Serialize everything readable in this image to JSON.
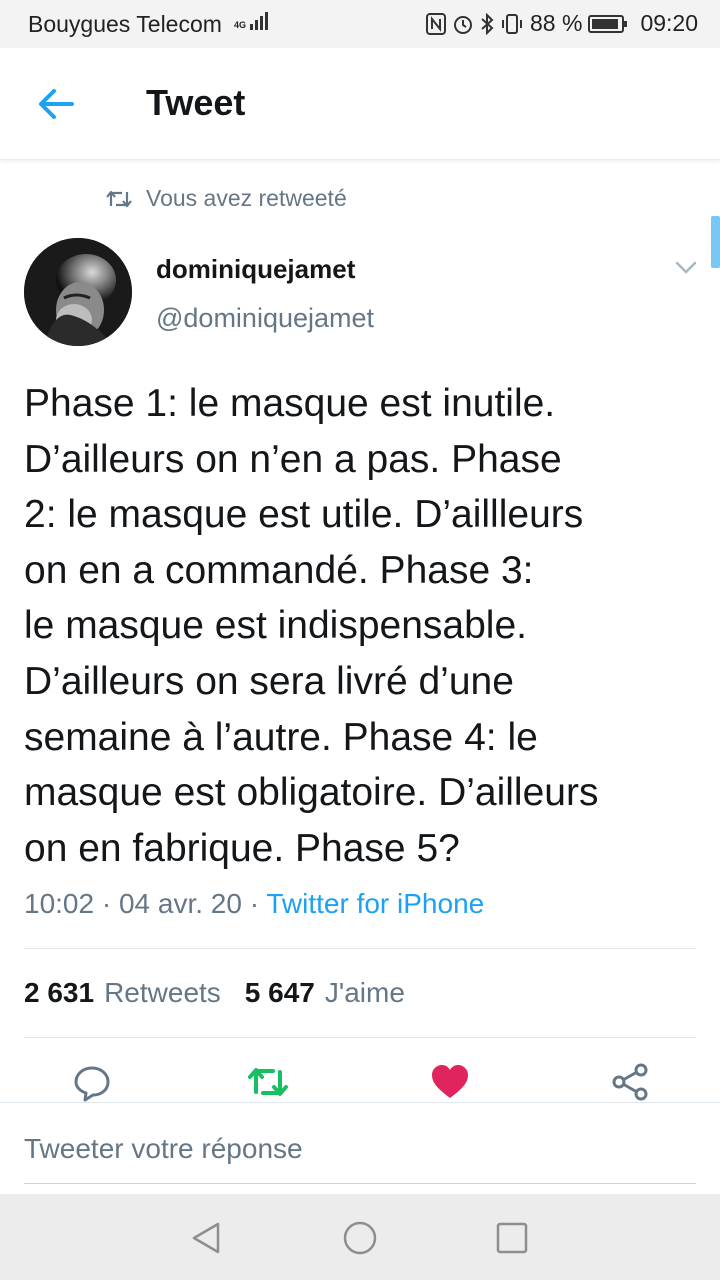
{
  "status_bar": {
    "carrier": "Bouygues Telecom",
    "network": "4G",
    "battery": "88 %",
    "time": "09:20"
  },
  "header": {
    "title": "Tweet"
  },
  "tweet": {
    "retweet_notice": "Vous avez retweeté",
    "display_name": "dominiquejamet",
    "handle": "@dominiquejamet",
    "text": "Phase 1: le masque est inutile.\nD’ailleurs on n’en a pas. Phase\n2: le masque est utile. D’aillleurs\non en a commandé. Phase 3:\nle masque est indispensable.\nD’ailleurs on sera livré d’une\nsemaine à l’autre. Phase 4: le\nmasque est obligatoire. D’ailleurs\non en fabrique. Phase 5?",
    "time": "10:02",
    "date": "04 avr. 20",
    "separator": "·",
    "source": "Twitter for iPhone",
    "retweets_count": "2 631",
    "retweets_label": "Retweets",
    "likes_count": "5 647",
    "likes_label": "J'aime"
  },
  "reply": {
    "placeholder": "Tweeter votre réponse"
  },
  "colors": {
    "accent": "#1da1f2",
    "retweet_green": "#17bf63",
    "like_red": "#e0245e",
    "muted": "#657786"
  }
}
